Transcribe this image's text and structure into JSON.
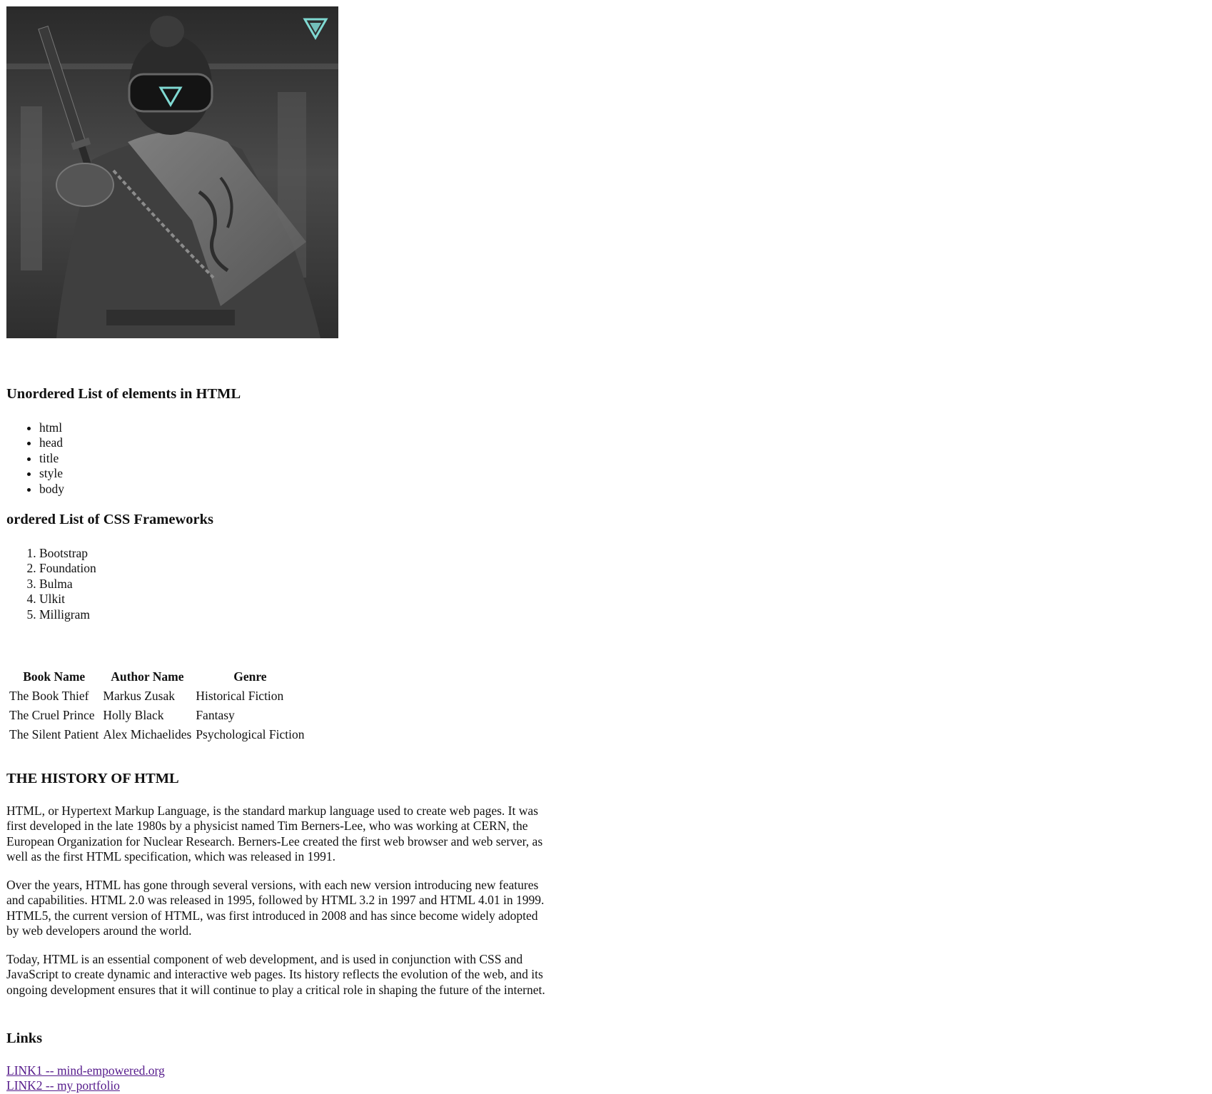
{
  "hero": {
    "icon": "triangle-logo-icon",
    "accent": "#7fd9d2"
  },
  "unordered": {
    "heading": "Unordered List of elements in HTML",
    "items": [
      "html",
      "head",
      "title",
      "style",
      "body"
    ]
  },
  "ordered": {
    "heading": "ordered List of CSS Frameworks",
    "items": [
      "Bootstrap",
      "Foundation",
      "Bulma",
      "Ulkit",
      "Milligram"
    ]
  },
  "table": {
    "headers": [
      "Book Name",
      "Author Name",
      "Genre"
    ],
    "rows": [
      [
        "The Book Thief",
        "Markus Zusak",
        "Historical Fiction"
      ],
      [
        "The Cruel Prince",
        "Holly Black",
        "Fantasy"
      ],
      [
        "The Silent Patient",
        "Alex Michaelides",
        "Psychological Fiction"
      ]
    ]
  },
  "history": {
    "heading": "THE HISTORY OF HTML",
    "paragraphs": [
      "HTML, or Hypertext Markup Language, is the standard markup language used to create web pages. It was first developed in the late 1980s by a physicist named Tim Berners-Lee, who was working at CERN, the European Organization for Nuclear Research. Berners-Lee created the first web browser and web server, as well as the first HTML specification, which was released in 1991.",
      "Over the years, HTML has gone through several versions, with each new version introducing new features and capabilities. HTML 2.0 was released in 1995, followed by HTML 3.2 in 1997 and HTML 4.01 in 1999. HTML5, the current version of HTML, was first introduced in 2008 and has since become widely adopted by web developers around the world.",
      "Today, HTML is an essential component of web development, and is used in conjunction with CSS and JavaScript to create dynamic and interactive web pages. Its history reflects the evolution of the web, and its ongoing development ensures that it will continue to play a critical role in shaping the future of the internet."
    ]
  },
  "links": {
    "heading": "Links",
    "items": [
      "LINK1 -- mind-empowered.org",
      "LINK2 -- my portfolio"
    ]
  }
}
